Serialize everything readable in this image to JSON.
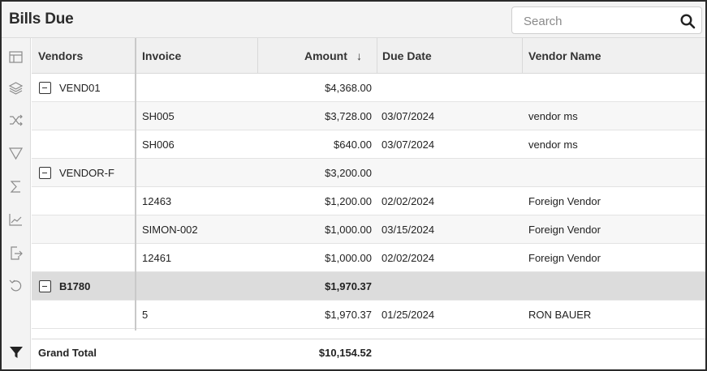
{
  "title": "Bills Due",
  "search": {
    "placeholder": "Search",
    "icon": "search-icon"
  },
  "sidebar": {
    "icons": [
      "table-icon",
      "layers-icon",
      "shuffle-icon",
      "funnel-icon",
      "sigma-icon",
      "line-chart-icon",
      "export-icon",
      "undo-icon"
    ],
    "bottom_icon": "filter-solid-icon"
  },
  "columns": {
    "vendors": "Vendors",
    "invoice": "Invoice",
    "amount": "Amount",
    "amount_sort": "↓",
    "due_date": "Due Date",
    "vendor_name": "Vendor Name"
  },
  "rows": [
    {
      "group": "VEND01",
      "invoice": "",
      "amount": "$4,368.00",
      "due": "",
      "name": ""
    },
    {
      "group": "",
      "invoice": "SH005",
      "amount": "$3,728.00",
      "due": "03/07/2024",
      "name": "vendor ms"
    },
    {
      "group": "",
      "invoice": "SH006",
      "amount": "$640.00",
      "due": "03/07/2024",
      "name": "vendor ms"
    },
    {
      "group": "VENDOR-F",
      "invoice": "",
      "amount": "$3,200.00",
      "due": "",
      "name": ""
    },
    {
      "group": "",
      "invoice": "12463",
      "amount": "$1,200.00",
      "due": "02/02/2024",
      "name": "Foreign Vendor"
    },
    {
      "group": "",
      "invoice": "SIMON-002",
      "amount": "$1,000.00",
      "due": "03/15/2024",
      "name": "Foreign Vendor"
    },
    {
      "group": "",
      "invoice": "12461",
      "amount": "$1,000.00",
      "due": "02/02/2024",
      "name": "Foreign Vendor"
    },
    {
      "group": "B1780",
      "invoice": "",
      "amount": "$1,970.37",
      "due": "",
      "name": ""
    },
    {
      "group": "",
      "invoice": "5",
      "amount": "$1,970.37",
      "due": "01/25/2024",
      "name": "RON BAUER"
    }
  ],
  "footer": {
    "label": "Grand Total",
    "amount": "$10,154.52"
  }
}
